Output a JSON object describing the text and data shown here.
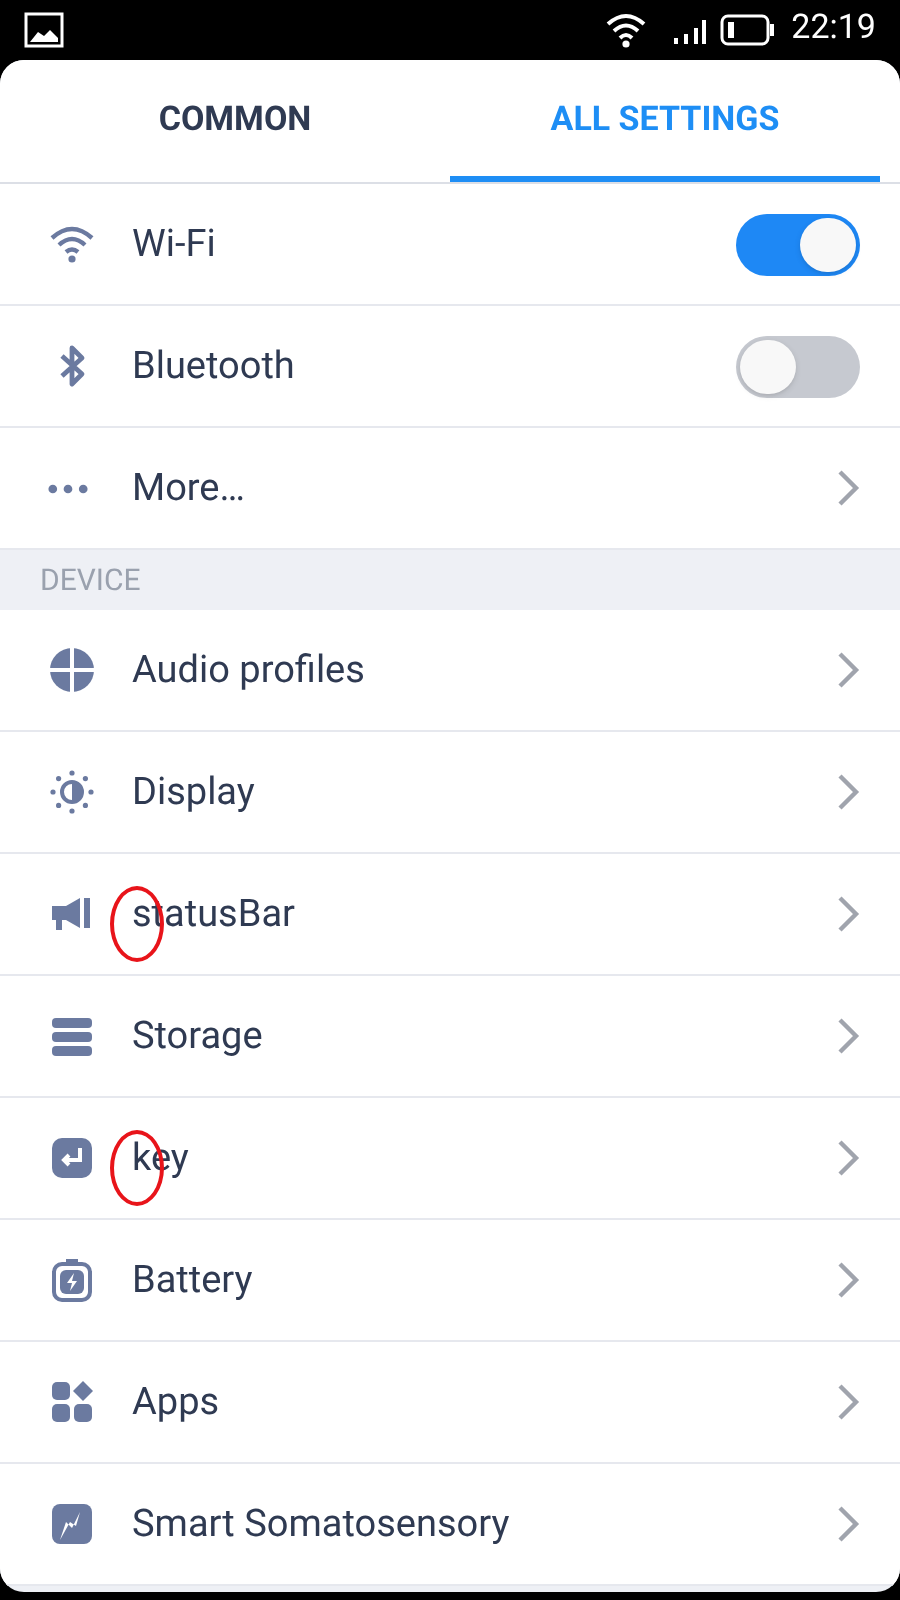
{
  "status_bar": {
    "time": "22:19"
  },
  "tabs": [
    {
      "label": "COMMON",
      "selected": false
    },
    {
      "label": "ALL SETTINGS",
      "selected": true
    }
  ],
  "sections": [
    {
      "items": [
        {
          "kind": "toggle",
          "label": "Wi-Fi",
          "on": true,
          "circled": false
        },
        {
          "kind": "toggle",
          "label": "Bluetooth",
          "on": false,
          "circled": false
        },
        {
          "kind": "link",
          "label": "More…",
          "circled": false
        }
      ]
    },
    {
      "header": "DEVICE",
      "items": [
        {
          "kind": "link",
          "label": "Audio profiles",
          "circled": false
        },
        {
          "kind": "link",
          "label": "Display",
          "circled": false
        },
        {
          "kind": "link",
          "label": "statusBar",
          "circled": true
        },
        {
          "kind": "link",
          "label": "Storage",
          "circled": false
        },
        {
          "kind": "link",
          "label": "key",
          "circled": true
        },
        {
          "kind": "link",
          "label": "Battery",
          "circled": false
        },
        {
          "kind": "link",
          "label": "Apps",
          "circled": false
        },
        {
          "kind": "link",
          "label": "Smart Somatosensory",
          "circled": false
        }
      ]
    }
  ]
}
